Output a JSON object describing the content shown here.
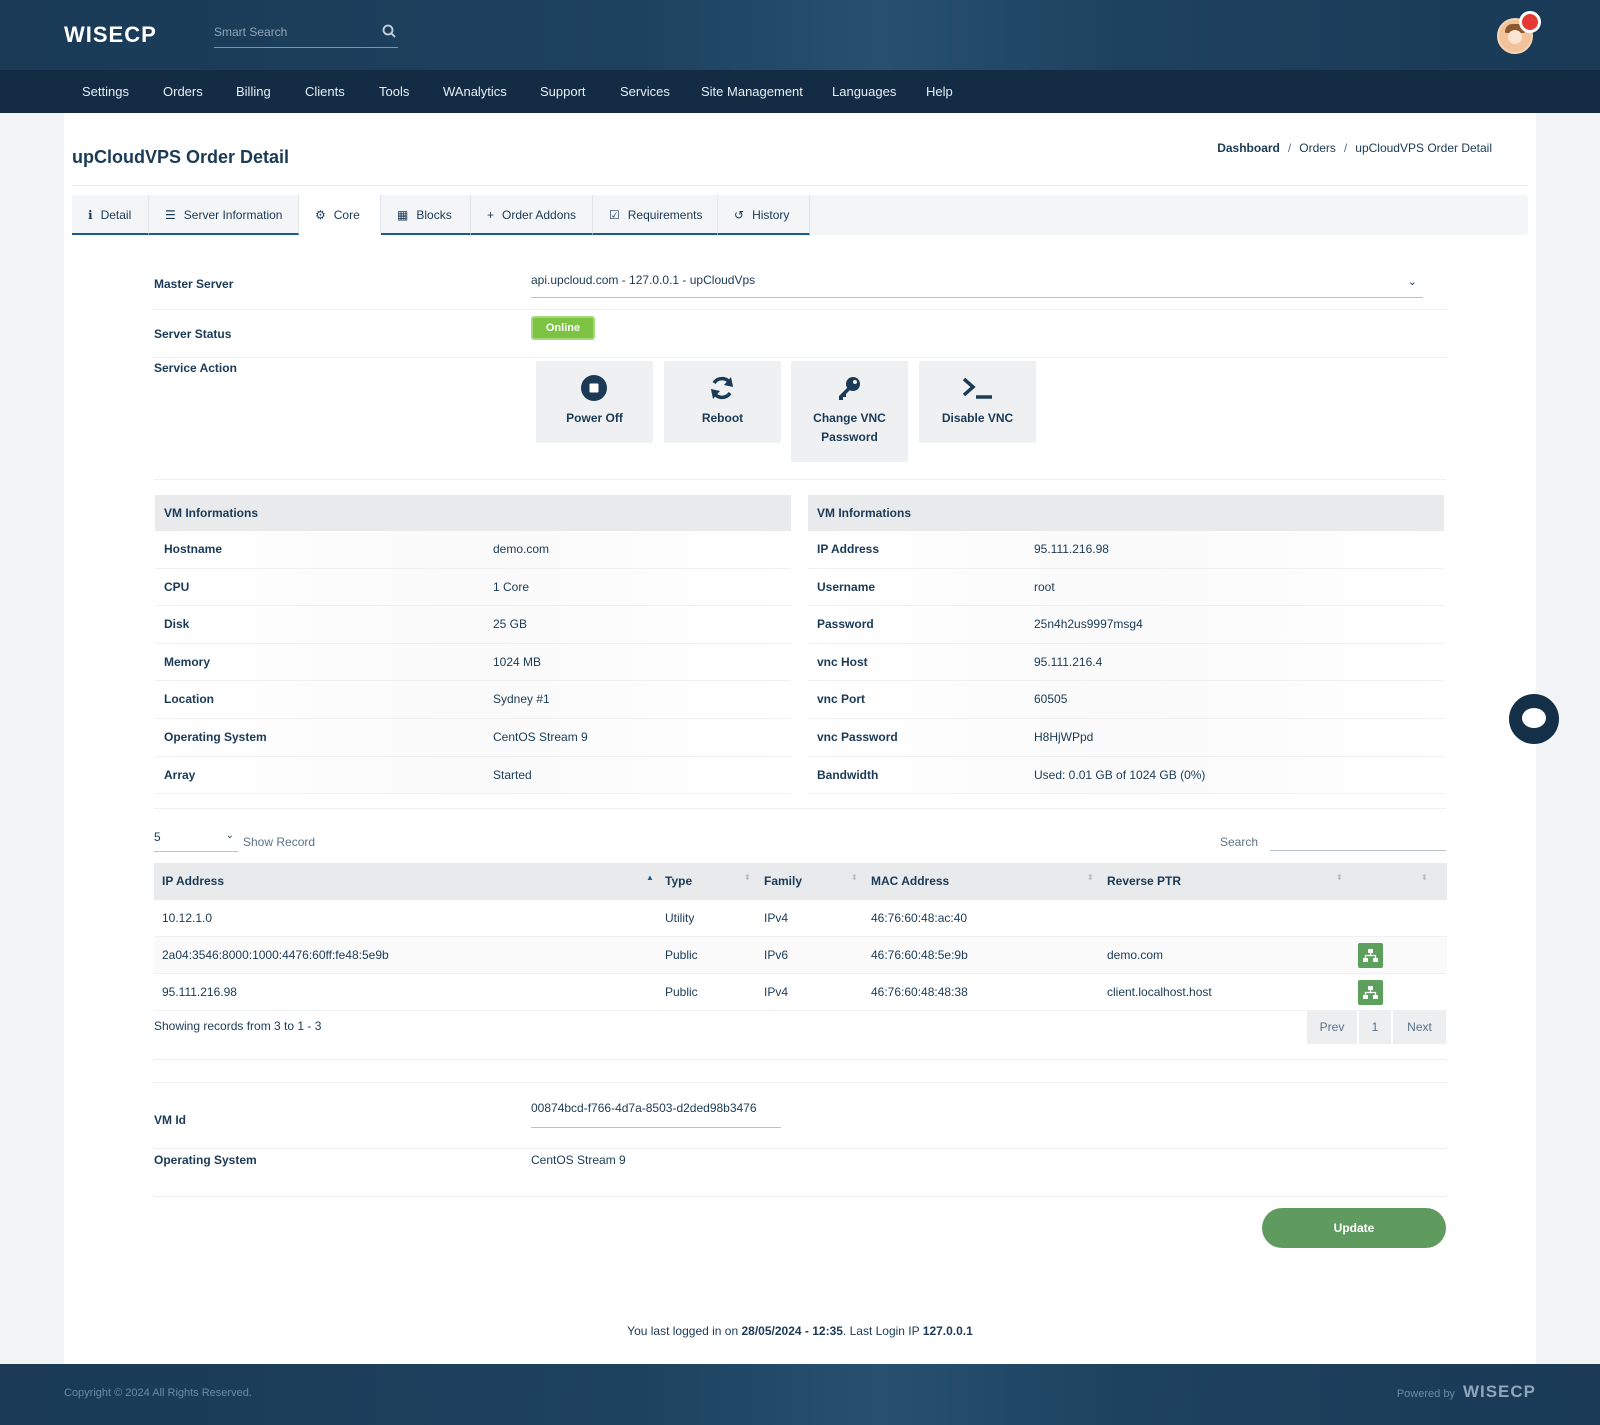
{
  "header": {
    "logo": "WISECP",
    "search_placeholder": "Smart Search"
  },
  "nav": [
    "Settings",
    "Orders",
    "Billing",
    "Clients",
    "Tools",
    "WAnalytics",
    "Support",
    "Services",
    "Site Management",
    "Languages",
    "Help"
  ],
  "page": {
    "title": "upCloudVPS Order Detail",
    "breadcrumb": [
      "Dashboard",
      "Orders",
      "upCloudVPS Order Detail"
    ]
  },
  "tabs": [
    {
      "label": "Detail",
      "icon": "info-icon"
    },
    {
      "label": "Server Information",
      "icon": "server-icon"
    },
    {
      "label": "Core",
      "icon": "gears-icon"
    },
    {
      "label": "Blocks",
      "icon": "grid-icon"
    },
    {
      "label": "Order Addons",
      "icon": "plus-icon"
    },
    {
      "label": "Requirements",
      "icon": "checkbox-icon"
    },
    {
      "label": "History",
      "icon": "history-icon"
    }
  ],
  "core": {
    "master_server_label": "Master Server",
    "master_server_value": "api.upcloud.com - 127.0.0.1 - upCloudVps",
    "server_status_label": "Server Status",
    "server_status_value": "Online",
    "service_action_label": "Service Action",
    "actions": [
      {
        "label": "Power Off",
        "icon": "stop-icon"
      },
      {
        "label": "Reboot",
        "icon": "refresh-icon"
      },
      {
        "label": "Change VNC Password",
        "icon": "key-icon"
      },
      {
        "label": "Disable VNC",
        "icon": "terminal-icon"
      }
    ]
  },
  "vm_left": {
    "title": "VM Informations",
    "rows": [
      {
        "k": "Hostname",
        "v": "demo.com"
      },
      {
        "k": "CPU",
        "v": "1 Core"
      },
      {
        "k": "Disk",
        "v": "25 GB"
      },
      {
        "k": "Memory",
        "v": "1024 MB"
      },
      {
        "k": "Location",
        "v": "Sydney #1"
      },
      {
        "k": "Operating System",
        "v": "CentOS Stream 9"
      },
      {
        "k": "Array",
        "v": "Started"
      }
    ]
  },
  "vm_right": {
    "title": "VM Informations",
    "rows": [
      {
        "k": "IP Address",
        "v": "95.111.216.98"
      },
      {
        "k": "Username",
        "v": "root"
      },
      {
        "k": "Password",
        "v": "25n4h2us9997msg4"
      },
      {
        "k": "vnc Host",
        "v": "95.111.216.4"
      },
      {
        "k": "vnc Port",
        "v": "60505"
      },
      {
        "k": "vnc Password",
        "v": "H8HjWPpd"
      },
      {
        "k": "Bandwidth",
        "v": "Used: 0.01 GB of 1024 GB (0%)"
      }
    ]
  },
  "ip_table": {
    "page_size": "5",
    "show_record_label": "Show Record",
    "search_label": "Search",
    "columns": [
      "IP Address",
      "Type",
      "Family",
      "MAC Address",
      "Reverse PTR"
    ],
    "rows": [
      {
        "ip": "10.12.1.0",
        "type": "Utility",
        "family": "IPv4",
        "mac": "46:76:60:48:ac:40",
        "ptr": "",
        "button": false
      },
      {
        "ip": "2a04:3546:8000:1000:4476:60ff:fe48:5e9b",
        "type": "Public",
        "family": "IPv6",
        "mac": "46:76:60:48:5e:9b",
        "ptr": "demo.com",
        "button": true
      },
      {
        "ip": "95.111.216.98",
        "type": "Public",
        "family": "IPv4",
        "mac": "46:76:60:48:48:38",
        "ptr": "client.localhost.host",
        "button": true
      }
    ],
    "showing_text": "Showing records from 3 to 1 - 3",
    "pager": [
      "Prev",
      "1",
      "Next"
    ]
  },
  "vm_meta": {
    "vm_id_label": "VM Id",
    "vm_id_value": "00874bcd-f766-4d7a-8503-d2ded98b3476",
    "os_label": "Operating System",
    "os_value": "CentOS Stream 9"
  },
  "update_label": "Update",
  "last_login": {
    "prefix": "You last logged in on ",
    "date": "28/05/2024 - 12:35",
    "middle": ". Last Login IP ",
    "ip": "127.0.0.1"
  },
  "footer": {
    "copyright": "Copyright © 2024 All Rights Reserved.",
    "powered_by": "Powered by",
    "logo": "WISECP"
  },
  "colors": {
    "primary": "#1a3a56",
    "online": "#7cc243",
    "update": "#5f9b5e"
  }
}
